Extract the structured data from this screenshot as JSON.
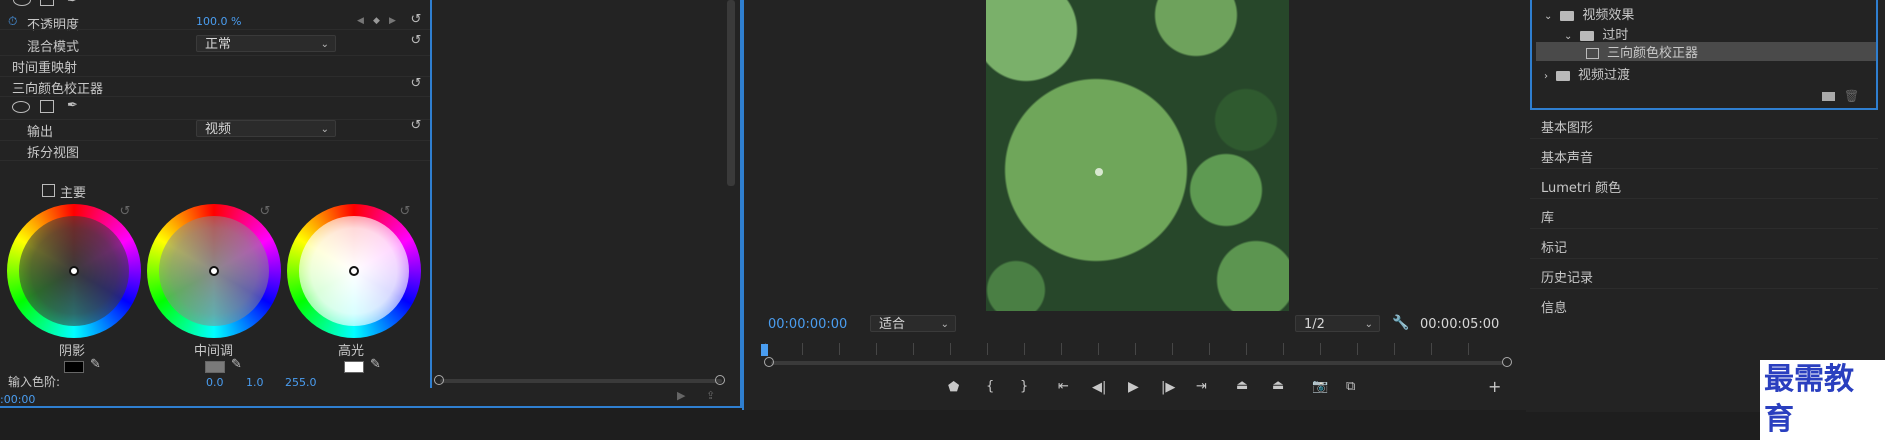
{
  "effect_controls": {
    "opacity_label": "不透明度",
    "opacity_value": "100.0 %",
    "blend_mode_label": "混合模式",
    "blend_mode_value": "正常",
    "time_remap_label": "时间重映射",
    "three_way_label": "三向颜色校正器",
    "output_label": "输出",
    "output_value": "视频",
    "split_view_label": "拆分视图",
    "master_label": "主要",
    "wheels": [
      {
        "label": "阴影",
        "swatch": "#000000"
      },
      {
        "label": "中间调",
        "swatch": "#7a7a7a"
      },
      {
        "label": "高光",
        "swatch": "#ffffff"
      }
    ],
    "input_levels_label": "输入色阶:",
    "input_levels": [
      "0.0",
      "1.0",
      "255.0"
    ],
    "timecode_bottom": ":00:00"
  },
  "program": {
    "current_time": "00:00:00:00",
    "fit_value": "适合",
    "resolution_value": "1/2",
    "duration": "00:00:05:00",
    "icons": [
      "marker-icon",
      "in-point-icon",
      "out-point-icon",
      "go-to-in-icon",
      "step-back-icon",
      "play-icon",
      "step-forward-icon",
      "go-to-out-icon",
      "lift-icon",
      "extract-icon",
      "camera-icon",
      "compare-icon",
      "add-icon",
      "wrench-icon"
    ]
  },
  "effects_tree": {
    "video_effects": "视频效果",
    "transition": "过时",
    "three_way": "三向颜色校正器",
    "video_transitions": "视频过渡"
  },
  "panels_menu": [
    "基本图形",
    "基本声音",
    "Lumetri 颜色",
    "库",
    "标记",
    "历史记录",
    "信息"
  ],
  "watermark": "最需教育",
  "colors": {
    "accent": "#2f7fd0",
    "timecode": "#4a9df0"
  }
}
